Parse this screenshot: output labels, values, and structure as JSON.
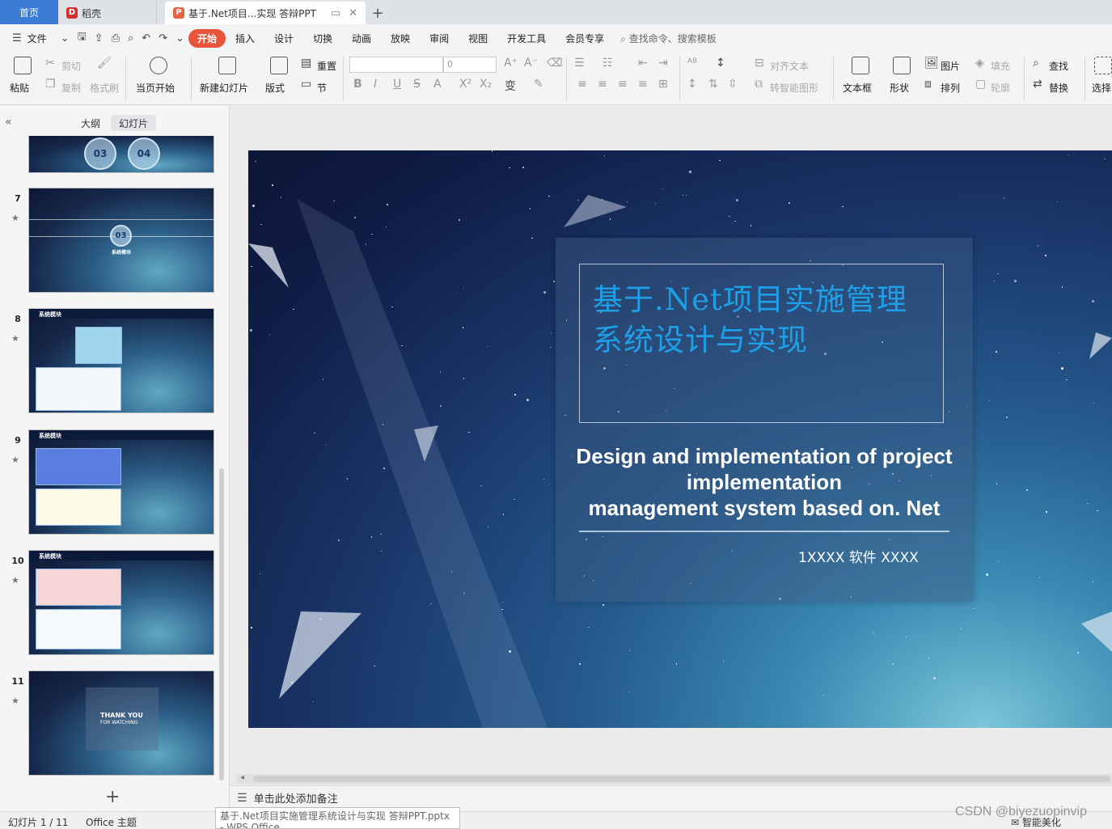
{
  "tabs": {
    "home": "首页",
    "daoke": "稻壳",
    "doc": "基于.Net项目...实现 答辩PPT",
    "add": "+"
  },
  "menu": {
    "file": "文件",
    "items": [
      "开始",
      "插入",
      "设计",
      "切换",
      "动画",
      "放映",
      "审阅",
      "视图",
      "开发工具",
      "会员专享"
    ],
    "search": "查找命令、搜索模板"
  },
  "ribbon": {
    "paste": "粘贴",
    "cut": "剪切",
    "copy": "复制",
    "format_painter": "格式刷",
    "from_current": "当页开始",
    "new_slide": "新建幻灯片",
    "layout": "版式",
    "reset": "重置",
    "section": "节",
    "font_size": "0",
    "align_text": "对齐文本",
    "smart_shape": "转智能图形",
    "textbox": "文本框",
    "shape": "形状",
    "picture": "图片",
    "arrange": "排列",
    "fill": "填充",
    "outline": "轮廓",
    "find": "查找",
    "replace": "替换",
    "select": "选择"
  },
  "left_panel": {
    "tab_outline": "大纲",
    "tab_slides": "幻灯片",
    "slides": [
      {
        "num": "7",
        "label": "03",
        "caption": "系统模块"
      },
      {
        "num": "8",
        "header": "系统模块"
      },
      {
        "num": "9",
        "header": "系统模块"
      },
      {
        "num": "10",
        "header": "系统模块"
      },
      {
        "num": "11",
        "thank": "THANK YOU",
        "thank_sub": "FOR WATCHING"
      }
    ],
    "top_partial": {
      "a": "03",
      "b": "04"
    }
  },
  "slide": {
    "title_cn": "基于.Net项目实施管理系统设计与实现",
    "title_en_1": "Design and implementation of project",
    "title_en_2": "implementation",
    "title_en_3": "management system based on. Net",
    "author": "1XXXX  软件  XXXX"
  },
  "notes": {
    "placeholder": "单击此处添加备注"
  },
  "status": {
    "slide_no": "幻灯片 1 / 11",
    "theme": "Office 主题",
    "smart": "智能美化",
    "tooltip": "基于.Net项目实施管理系统设计与实现 答辩PPT.pptx - WPS Office"
  },
  "watermark": "CSDN @biyezuopinvip"
}
